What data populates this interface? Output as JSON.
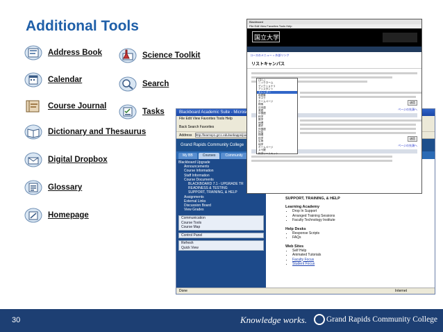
{
  "slide": {
    "title": "Additional Tools",
    "page_number": "30",
    "tagline": "Knowledge works.",
    "college": "Grand Rapids Community College"
  },
  "tools_left": [
    {
      "label": "Address Book",
      "icon": "address-book-icon"
    },
    {
      "label": "Calendar",
      "icon": "calendar-icon"
    },
    {
      "label": "Course Journal",
      "icon": "journal-icon"
    },
    {
      "label": "Dictionary and Thesaurus",
      "icon": "book-icon"
    },
    {
      "label": "Digital Dropbox",
      "icon": "dropbox-icon"
    },
    {
      "label": "Glossary",
      "icon": "glossary-icon"
    },
    {
      "label": "Homepage",
      "icon": "homepage-icon"
    }
  ],
  "tools_right": [
    {
      "label": "Science Toolkit",
      "icon": "science-icon"
    },
    {
      "label": "Search",
      "icon": "search-icon"
    },
    {
      "label": "Tasks",
      "icon": "tasks-icon"
    }
  ],
  "browser_back": {
    "title": "Blackboard Academic Suite - Microsoft Internet Explorer",
    "menu": "File   Edit   View   Favorites   Tools   Help",
    "toolbar": "Back   Search   Favorites",
    "address_label": "Address",
    "address": "http://learnsp1.grcc.edu/webapps/portal",
    "banner": "Grand Rapids Community College",
    "tabs": [
      "My BB",
      "Courses",
      "Community",
      "Ka"
    ],
    "nav_header": "Blackboard Upgrade",
    "tree": [
      "Blackboard Upgrade",
      "Announcements",
      "Course Information",
      "Staff Information",
      "Course Documents",
      "BLACKBOARD 7.1 - UPGRADE TR",
      "READINESS & TESTING",
      "SUPPORT, TRAINING, & HELP",
      "Assignments",
      "External Links",
      "Discussion Board",
      "View Grades"
    ],
    "panel1": [
      "Communication",
      "Course Tools",
      "Course Map"
    ],
    "panel2": [
      "Control Panel"
    ],
    "panel3": [
      "Refresh",
      "Quick View"
    ],
    "content_title": "SUPPORT, TRAINING, & HELP",
    "sections": [
      {
        "heading": "Learning Academy",
        "items": [
          "Drop In Support",
          "Arranged Training Sessions",
          "Faculty Technology Institute"
        ]
      },
      {
        "heading": "Help Desks",
        "items": [
          "Response Scripts",
          "FAQs"
        ]
      },
      {
        "heading": "Web Sites",
        "items": [
          "Self Help",
          "Animated Tutorials",
          "Faculty Focus",
          "Student Focus"
        ]
      }
    ],
    "status_left": "Done",
    "status_right": "Internet"
  },
  "browser_front": {
    "title": "Blackboard",
    "menu": "File   Edit   View   Favorites   Tools   Help",
    "logo_text": "国立大学",
    "nav_tab": "外部リンク",
    "crumbs": "コースのメニュー > 外部リンク",
    "page_title": "リストキャンパス",
    "dropdown_options": [
      "(なし)",
      "ニックネーム",
      "ディクショナリ",
      "アシスタント",
      "カレンダー",
      "用語集",
      "タスク",
      "ホームページ",
      "検索",
      "日本語",
      "英語",
      "中国語",
      "科学",
      "数学",
      "地理",
      "歴史",
      "外国語",
      "社会",
      "物理",
      "化学",
      "生物",
      "地学",
      "ホームページ",
      "メモ帳",
      "科学ツールキット"
    ],
    "row_button": "送信",
    "link": "ページの先頭へ"
  },
  "colors": {
    "title": "#1f5fa8",
    "footer": "#1d3f73",
    "bb_blue": "#1d4a8a"
  }
}
